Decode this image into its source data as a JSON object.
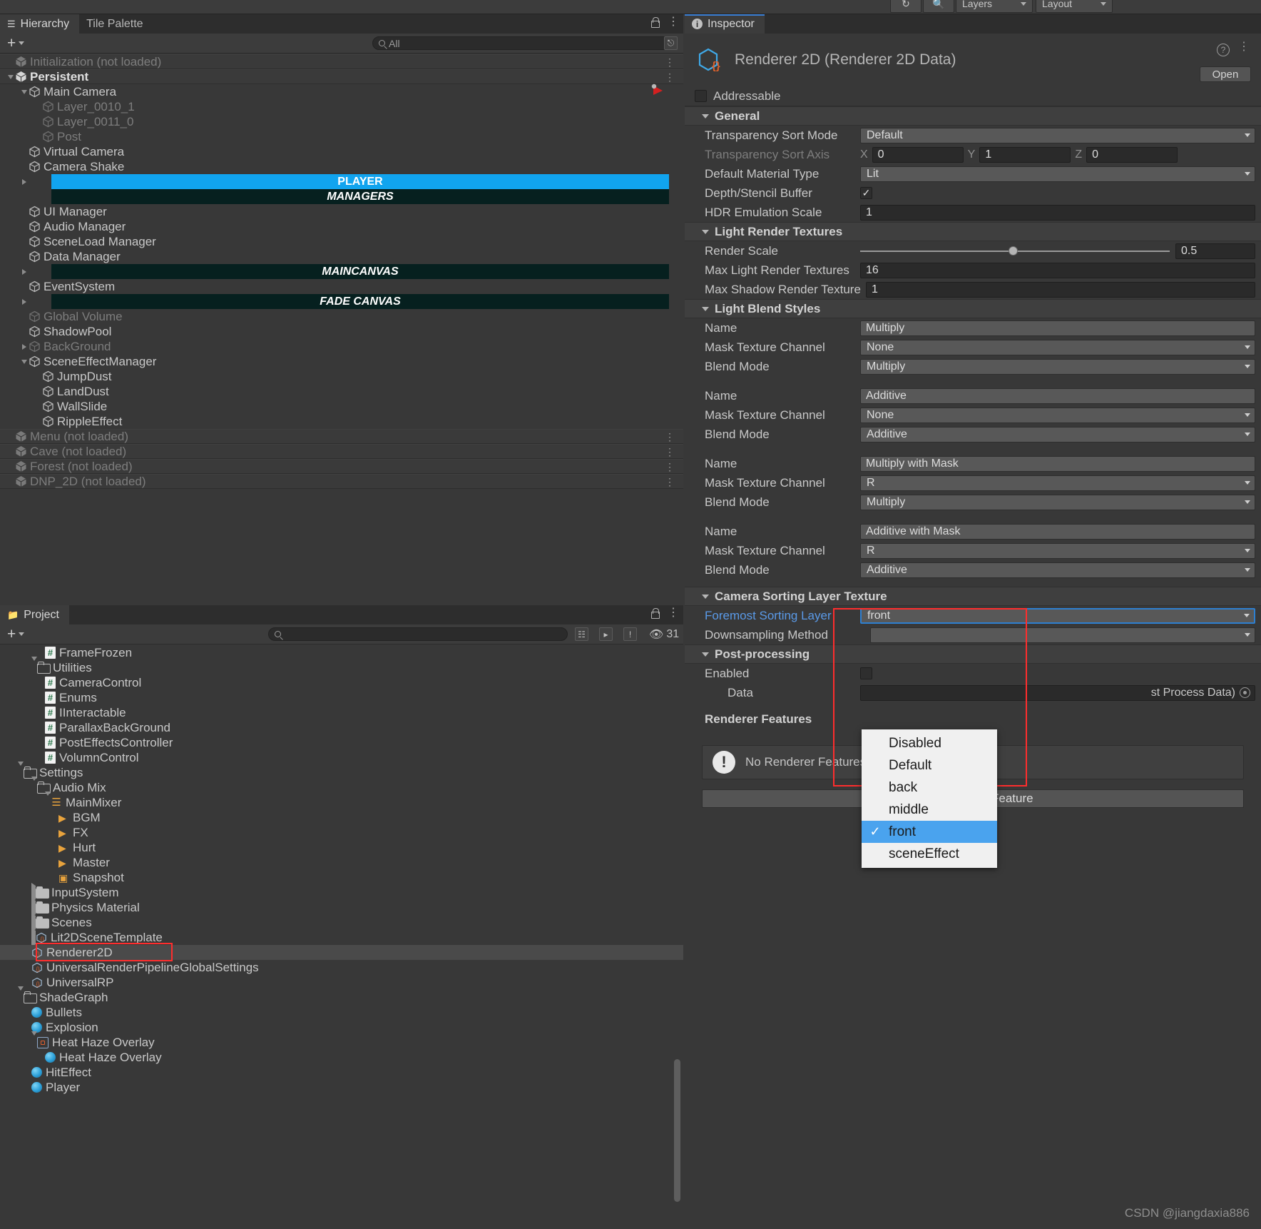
{
  "toolbar": {
    "undo_icon": "history-icon",
    "search_icon": "search-icon",
    "layers_label": "Layers",
    "layout_label": "Layout"
  },
  "hierarchy": {
    "tab_label": "Hierarchy",
    "tab2_label": "Tile Palette",
    "search_placeholder": "All",
    "add_label": "+",
    "items": [
      {
        "label": "Initialization (not loaded)",
        "indent": 0,
        "type": "scene",
        "dim": true,
        "arrow": "",
        "kebab": true
      },
      {
        "label": "Persistent",
        "indent": 0,
        "type": "scene",
        "bold": true,
        "arrow": "down",
        "kebab": true
      },
      {
        "label": "Main Camera",
        "indent": 1,
        "type": "go",
        "arrow": "down"
      },
      {
        "label": "Layer_0010_1",
        "indent": 2,
        "type": "go",
        "dim": true
      },
      {
        "label": "Layer_0011_0",
        "indent": 2,
        "type": "go",
        "dim": true
      },
      {
        "label": "Post",
        "indent": 2,
        "type": "go",
        "dim": true
      },
      {
        "label": "Virtual Camera",
        "indent": 1,
        "type": "go"
      },
      {
        "label": "Camera Shake",
        "indent": 1,
        "type": "go"
      },
      {
        "label": "PLAYER",
        "indent": 1,
        "type": "banner-blue",
        "arrow": "right"
      },
      {
        "label": "MANAGERS",
        "indent": 1,
        "type": "banner-dark"
      },
      {
        "label": "UI Manager",
        "indent": 1,
        "type": "go"
      },
      {
        "label": "Audio Manager",
        "indent": 1,
        "type": "go"
      },
      {
        "label": "SceneLoad Manager",
        "indent": 1,
        "type": "go"
      },
      {
        "label": "Data Manager",
        "indent": 1,
        "type": "go"
      },
      {
        "label": "MAINCANVAS",
        "indent": 1,
        "type": "banner-dark",
        "arrow": "right"
      },
      {
        "label": "EventSystem",
        "indent": 1,
        "type": "go"
      },
      {
        "label": "FADE CANVAS",
        "indent": 1,
        "type": "banner-dark",
        "arrow": "right"
      },
      {
        "label": "Global Volume",
        "indent": 1,
        "type": "go",
        "dim": true
      },
      {
        "label": "ShadowPool",
        "indent": 1,
        "type": "go"
      },
      {
        "label": "BackGround",
        "indent": 1,
        "type": "go",
        "dim": true,
        "arrow": "right"
      },
      {
        "label": "SceneEffectManager",
        "indent": 1,
        "type": "go",
        "arrow": "down"
      },
      {
        "label": "JumpDust",
        "indent": 2,
        "type": "go"
      },
      {
        "label": "LandDust",
        "indent": 2,
        "type": "go"
      },
      {
        "label": "WallSlide",
        "indent": 2,
        "type": "go"
      },
      {
        "label": "RippleEffect",
        "indent": 2,
        "type": "go"
      },
      {
        "label": "Menu (not loaded)",
        "indent": 0,
        "type": "scene",
        "dim": true,
        "kebab": true
      },
      {
        "label": "Cave (not loaded)",
        "indent": 0,
        "type": "scene",
        "dim": true,
        "kebab": true
      },
      {
        "label": "Forest (not loaded)",
        "indent": 0,
        "type": "scene",
        "dim": true,
        "kebab": true
      },
      {
        "label": "DNP_2D (not loaded)",
        "indent": 0,
        "type": "scene",
        "dim": true,
        "kebab": true
      }
    ]
  },
  "project": {
    "tab_label": "Project",
    "add_label": "+",
    "search_placeholder": "",
    "hidden_count": "31",
    "items": [
      {
        "label": "FrameFrozen",
        "indent": 3,
        "type": "cs"
      },
      {
        "label": "Utilities",
        "indent": 2,
        "type": "folder",
        "arrow": "down"
      },
      {
        "label": "CameraControl",
        "indent": 3,
        "type": "cs"
      },
      {
        "label": "Enums",
        "indent": 3,
        "type": "cs"
      },
      {
        "label": "IInteractable",
        "indent": 3,
        "type": "cs"
      },
      {
        "label": "ParallaxBackGround",
        "indent": 3,
        "type": "cs"
      },
      {
        "label": "PostEffectsController",
        "indent": 3,
        "type": "cs"
      },
      {
        "label": "VolumnControl",
        "indent": 3,
        "type": "cs"
      },
      {
        "label": "Settings",
        "indent": 1,
        "type": "folder",
        "arrow": "down"
      },
      {
        "label": "Audio Mix",
        "indent": 2,
        "type": "folder",
        "arrow": "down"
      },
      {
        "label": "MainMixer",
        "indent": 3,
        "type": "mixer",
        "arrow": "down"
      },
      {
        "label": "BGM",
        "indent": 4,
        "type": "group"
      },
      {
        "label": "FX",
        "indent": 4,
        "type": "group"
      },
      {
        "label": "Hurt",
        "indent": 4,
        "type": "group"
      },
      {
        "label": "Master",
        "indent": 4,
        "type": "group"
      },
      {
        "label": "Snapshot",
        "indent": 4,
        "type": "snapshot"
      },
      {
        "label": "InputSystem",
        "indent": 2,
        "type": "folder-solid",
        "arrow": "right"
      },
      {
        "label": "Physics Material",
        "indent": 2,
        "type": "folder-solid",
        "arrow": "right"
      },
      {
        "label": "Scenes",
        "indent": 2,
        "type": "folder-solid",
        "arrow": "right"
      },
      {
        "label": "Lit2DSceneTemplate",
        "indent": 2,
        "type": "asset",
        "arrow": "right"
      },
      {
        "label": "Renderer2D",
        "indent": 2,
        "type": "asset",
        "selected": true
      },
      {
        "label": "UniversalRenderPipelineGlobalSettings",
        "indent": 2,
        "type": "asset"
      },
      {
        "label": "UniversalRP",
        "indent": 2,
        "type": "asset"
      },
      {
        "label": "ShadeGraph",
        "indent": 1,
        "type": "folder",
        "arrow": "down"
      },
      {
        "label": "Bullets",
        "indent": 2,
        "type": "sphere"
      },
      {
        "label": "Explosion",
        "indent": 2,
        "type": "sphere"
      },
      {
        "label": "Heat Haze Overlay",
        "indent": 2,
        "type": "shader",
        "arrow": "down"
      },
      {
        "label": "Heat Haze Overlay",
        "indent": 3,
        "type": "sphere"
      },
      {
        "label": "HitEffect",
        "indent": 2,
        "type": "sphere"
      },
      {
        "label": "Player",
        "indent": 2,
        "type": "sphere"
      }
    ]
  },
  "inspector": {
    "tab_label": "Inspector",
    "asset_title": "Renderer 2D (Renderer 2D Data)",
    "open_button": "Open",
    "addressable_label": "Addressable",
    "addressable_checked": false,
    "sections": {
      "general": {
        "title": "General",
        "transparency_sort_mode_label": "Transparency Sort Mode",
        "transparency_sort_mode_value": "Default",
        "transparency_sort_axis_label": "Transparency Sort Axis",
        "axis_x_label": "X",
        "axis_x_value": "0",
        "axis_y_label": "Y",
        "axis_y_value": "1",
        "axis_z_label": "Z",
        "axis_z_value": "0",
        "default_material_type_label": "Default Material Type",
        "default_material_type_value": "Lit",
        "depth_stencil_label": "Depth/Stencil Buffer",
        "depth_stencil_checked": true,
        "hdr_label": "HDR Emulation Scale",
        "hdr_value": "1"
      },
      "light_render_textures": {
        "title": "Light Render Textures",
        "render_scale_label": "Render Scale",
        "render_scale_value": "0.5",
        "max_light_label": "Max Light Render Textures",
        "max_light_value": "16",
        "max_shadow_label": "Max Shadow Render Texture",
        "max_shadow_value": "1"
      },
      "light_blend_styles": {
        "title": "Light Blend Styles",
        "name_label": "Name",
        "mask_label": "Mask Texture Channel",
        "blend_label": "Blend Mode",
        "styles": [
          {
            "name": "Multiply",
            "mask": "None",
            "blend": "Multiply"
          },
          {
            "name": "Additive",
            "mask": "None",
            "blend": "Additive"
          },
          {
            "name": "Multiply with Mask",
            "mask": "R",
            "blend": "Multiply"
          },
          {
            "name": "Additive with Mask",
            "mask": "R",
            "blend": "Additive"
          }
        ]
      },
      "camera_sorting": {
        "title": "Camera Sorting Layer Texture",
        "foremost_label": "Foremost Sorting Layer",
        "foremost_value": "front",
        "downsampling_label": "Downsampling Method"
      },
      "post_processing": {
        "title": "Post-processing",
        "enabled_label": "Enabled",
        "data_label": "Data",
        "data_value": "st Process Data)"
      },
      "renderer_features": {
        "title": "Renderer Features",
        "empty_message": "No Renderer Features added",
        "add_button": "Add Renderer Feature"
      }
    },
    "dropdown": {
      "options": [
        "Disabled",
        "Default",
        "back",
        "middle",
        "front",
        "sceneEffect"
      ],
      "selected": "front",
      "check_glyph": "✓"
    }
  },
  "watermark": "CSDN @jiangdaxia886",
  "colors": {
    "accent_blue": "#11a4ef",
    "banner_dark": "#06201f",
    "highlight_red": "#ff2d2d",
    "dropdown_sel": "#4aa3ee",
    "link_blue": "#5a9ae8"
  }
}
